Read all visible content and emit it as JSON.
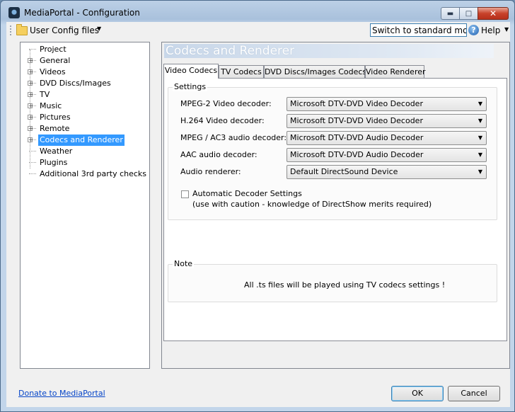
{
  "window": {
    "title": "MediaPortal - Configuration"
  },
  "toolbar": {
    "user_config": "User Config files",
    "switch_mode": "Switch to standard mode",
    "help": "Help"
  },
  "tree": {
    "items": [
      {
        "label": "Project",
        "expandable": false
      },
      {
        "label": "General",
        "expandable": true
      },
      {
        "label": "Videos",
        "expandable": true
      },
      {
        "label": "DVD Discs/Images",
        "expandable": true
      },
      {
        "label": "TV",
        "expandable": true
      },
      {
        "label": "Music",
        "expandable": true
      },
      {
        "label": "Pictures",
        "expandable": true
      },
      {
        "label": "Remote",
        "expandable": true
      },
      {
        "label": "Codecs and Renderer",
        "expandable": true,
        "selected": true
      },
      {
        "label": "Weather",
        "expandable": false
      },
      {
        "label": "Plugins",
        "expandable": false
      },
      {
        "label": "Additional 3rd party checks",
        "expandable": false
      }
    ]
  },
  "panel": {
    "title": "Codecs and Renderer",
    "tabs": [
      "Video Codecs",
      "TV Codecs",
      "DVD Discs/Images Codecs",
      "Video Renderer"
    ],
    "active_tab": "Video Codecs",
    "settings": {
      "title": "Settings",
      "fields": [
        {
          "label": "MPEG-2 Video decoder:",
          "value": "Microsoft DTV-DVD Video Decoder"
        },
        {
          "label": "H.264 Video decoder:",
          "value": "Microsoft DTV-DVD Video Decoder"
        },
        {
          "label": "MPEG / AC3 audio decoder:",
          "value": "Microsoft DTV-DVD Audio Decoder"
        },
        {
          "label": "AAC audio decoder:",
          "value": "Microsoft DTV-DVD Audio Decoder"
        },
        {
          "label": "Audio renderer:",
          "value": "Default DirectSound Device"
        }
      ],
      "auto_decoder": {
        "label": "Automatic  Decoder  Settings",
        "note": "(use with caution - knowledge of DirectShow merits required)",
        "checked": false
      }
    },
    "note": {
      "title": "Note",
      "text": "All .ts files will be played using TV codecs settings !"
    }
  },
  "footer": {
    "donate": "Donate to MediaPortal",
    "ok": "OK",
    "cancel": "Cancel"
  }
}
